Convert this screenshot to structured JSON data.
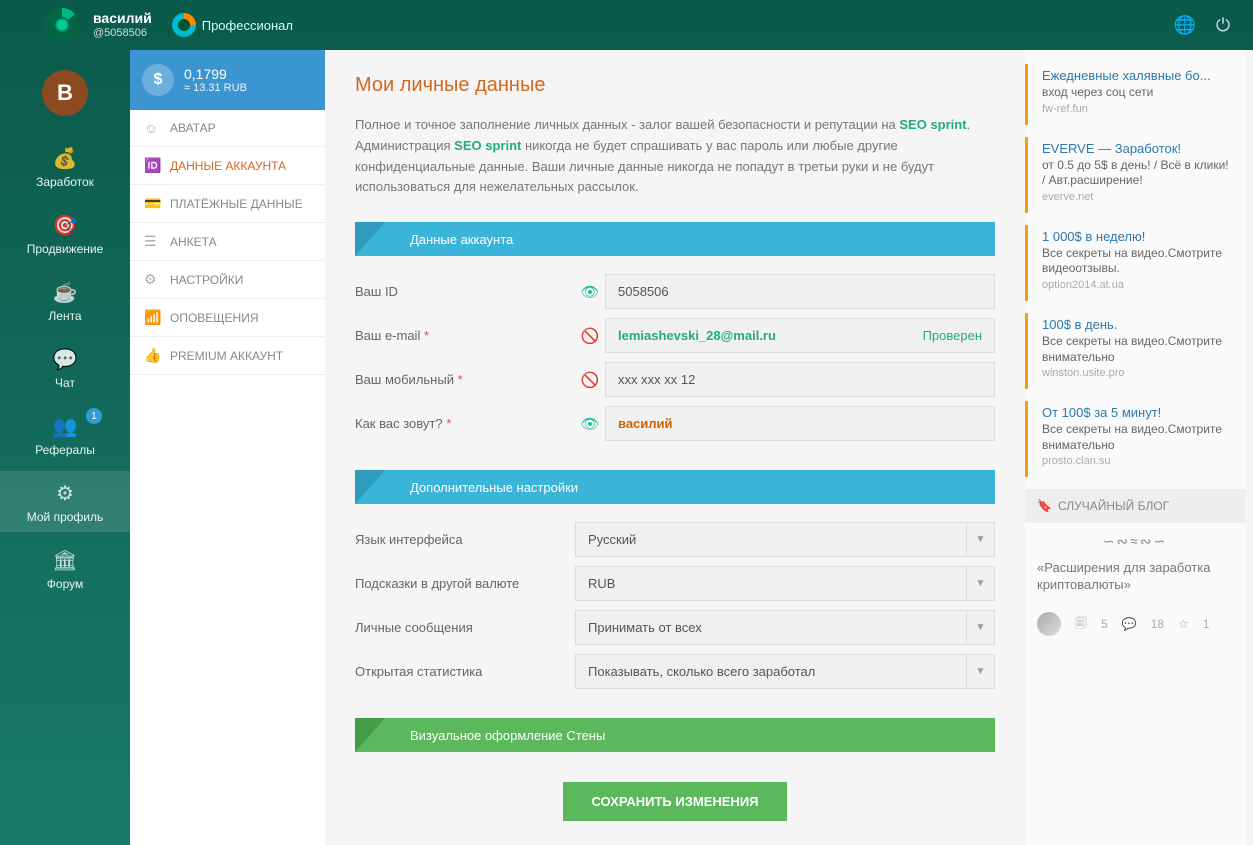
{
  "top": {
    "username": "василий",
    "userid": "@5058506",
    "status": "Профессионал"
  },
  "leftnav": {
    "avatar_letter": "В",
    "items": [
      {
        "label": "Заработок"
      },
      {
        "label": "Продвижение"
      },
      {
        "label": "Лента"
      },
      {
        "label": "Чат"
      },
      {
        "label": "Рефералы",
        "badge": "1"
      },
      {
        "label": "Мой профиль"
      },
      {
        "label": "Форум"
      }
    ]
  },
  "balance": {
    "main": "0,1799",
    "sub": "≈ 13.31 RUB"
  },
  "sidemenu": [
    {
      "label": "АВАТАР"
    },
    {
      "label": "ДАННЫЕ АККАУНТА"
    },
    {
      "label": "ПЛАТЁЖНЫЕ ДАННЫЕ"
    },
    {
      "label": "АНКЕТА"
    },
    {
      "label": "НАСТРОЙКИ"
    },
    {
      "label": "ОПОВЕЩЕНИЯ"
    },
    {
      "label": "PREMIUM АККАУНТ"
    }
  ],
  "page": {
    "title": "Мои личные данные",
    "intro_p1a": "Полное и точное заполнение личных данных - залог вашей безопасности и репутации на ",
    "intro_brand1": "SEO sprint",
    "intro_p1b": ". Администрация ",
    "intro_brand2": "SEO sprint",
    "intro_p1c": " никогда не будет спрашивать у вас пароль или любые другие конфиденциальные данные. Ваши личные данные никогда не попадут в третьи руки и не будут использоваться для нежелательных рассылок."
  },
  "section1": {
    "title": "Данные аккаунта",
    "rows": {
      "id": {
        "label": "Ваш ID",
        "value": "5058506"
      },
      "email": {
        "label": "Ваш e-mail",
        "value": "lemiashevski_28@mail.ru",
        "status": "Проверен"
      },
      "mobile": {
        "label": "Ваш мобильный",
        "value": "xxx xxx xx 12"
      },
      "name": {
        "label": "Как вас зовут?",
        "value": "василий"
      }
    }
  },
  "section2": {
    "title": "Дополнительные настройки",
    "rows": {
      "lang": {
        "label": "Язык интерфейса",
        "value": "Русский"
      },
      "currency": {
        "label": "Подсказки в другой валюте",
        "value": "RUB"
      },
      "messages": {
        "label": "Личные сообщения",
        "value": "Принимать от всех"
      },
      "stats": {
        "label": "Открытая статистика",
        "value": "Показывать, сколько всего заработал"
      }
    }
  },
  "section3": {
    "title": "Визуальное оформление Стены"
  },
  "save_label": "СОХРАНИТЬ ИЗМЕНЕНИЯ",
  "ads": [
    {
      "title": "Ежедневные халявные бо...",
      "desc": "вход через соц сети",
      "url": "fw-ref.fun"
    },
    {
      "title": "EVERVE — Заработок!",
      "desc": "от 0.5 до 5$ в день! / Всё в клики! / Авт.расширение!",
      "url": "everve.net"
    },
    {
      "title": "1 000$ в неделю!",
      "desc": "Все секреты на видео.Смотрите видеоотзывы.",
      "url": "option2014.at.ua"
    },
    {
      "title": "100$ в день.",
      "desc": "Все секреты на видео.Смотрите внимательно",
      "url": "winston.usite.pro"
    },
    {
      "title": "От 100$ за 5 минут!",
      "desc": "Все секреты на видео.Смотрите внимательно",
      "url": "prosto.clan.su"
    }
  ],
  "blog": {
    "header": "СЛУЧАЙНЫЙ БЛОГ",
    "text": "«Расширения для заработка криптовалюты»",
    "s1": "5",
    "s2": "18",
    "s3": "1"
  }
}
